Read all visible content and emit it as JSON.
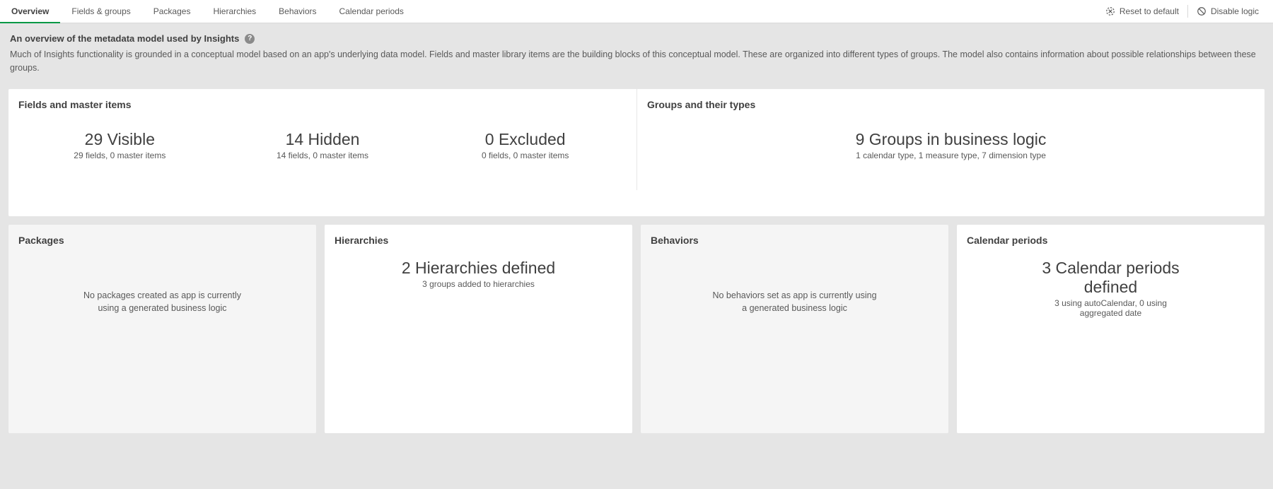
{
  "tabs": [
    {
      "label": "Overview",
      "active": true
    },
    {
      "label": "Fields & groups",
      "active": false
    },
    {
      "label": "Packages",
      "active": false
    },
    {
      "label": "Hierarchies",
      "active": false
    },
    {
      "label": "Behaviors",
      "active": false
    },
    {
      "label": "Calendar periods",
      "active": false
    }
  ],
  "actions": {
    "reset": "Reset to default",
    "disable": "Disable logic"
  },
  "intro": {
    "title": "An overview of the metadata model used by Insights",
    "desc": "Much of Insights functionality is grounded in a conceptual model based on an app's underlying data model. Fields and master library items are the building blocks of this conceptual model. These are organized into different types of groups. The model also contains information about possible relationships between these groups."
  },
  "fieldsCard": {
    "title": "Fields and master items",
    "stats": [
      {
        "big": "29 Visible",
        "small": "29 fields, 0 master items"
      },
      {
        "big": "14 Hidden",
        "small": "14 fields, 0 master items"
      },
      {
        "big": "0 Excluded",
        "small": "0 fields, 0 master items"
      }
    ]
  },
  "groupsCard": {
    "title": "Groups and their types",
    "stat": {
      "big": "9 Groups in business logic",
      "small": "1 calendar type, 1 measure type, 7 dimension type"
    }
  },
  "packagesCard": {
    "title": "Packages",
    "empty": "No packages created as app is currently using a generated business logic"
  },
  "hierarchiesCard": {
    "title": "Hierarchies",
    "stat": {
      "big": "2 Hierarchies defined",
      "small": "3 groups added to hierarchies"
    }
  },
  "behaviorsCard": {
    "title": "Behaviors",
    "empty": "No behaviors set as app is currently using a generated business logic"
  },
  "calendarCard": {
    "title": "Calendar periods",
    "stat": {
      "big": "3 Calendar periods defined",
      "small": "3 using autoCalendar, 0 using aggregated date"
    }
  }
}
